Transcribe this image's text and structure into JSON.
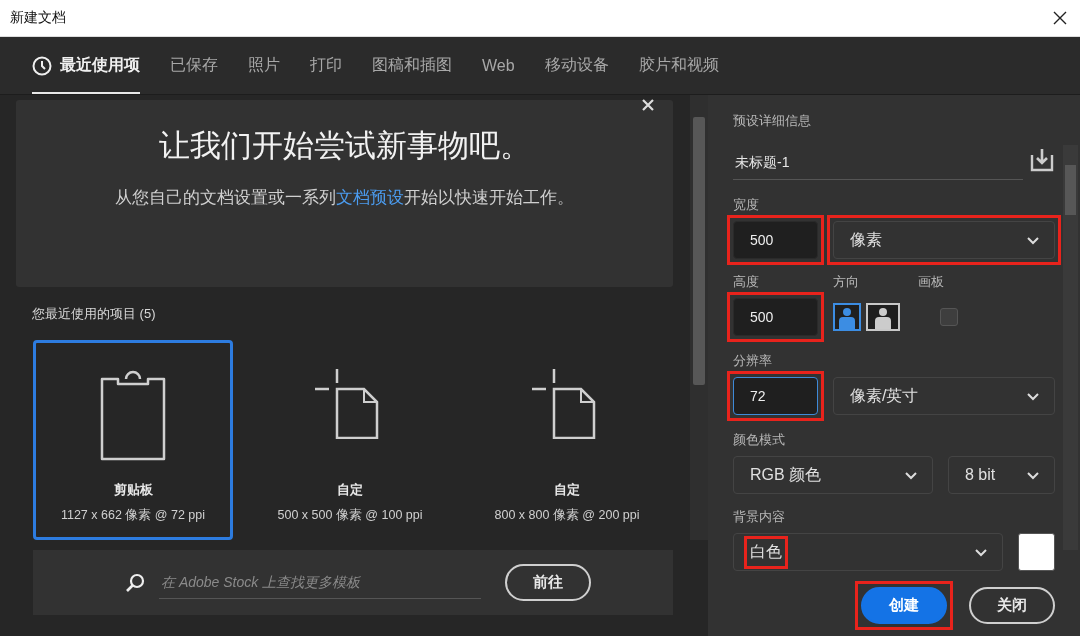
{
  "window": {
    "title": "新建文档"
  },
  "tabs": [
    {
      "label": "最近使用项",
      "selected": true,
      "kind": "icon"
    },
    {
      "label": "已保存",
      "selected": false,
      "kind": "text"
    },
    {
      "label": "照片",
      "selected": false,
      "kind": "text"
    },
    {
      "label": "打印",
      "selected": false,
      "kind": "text"
    },
    {
      "label": "图稿和插图",
      "selected": false,
      "kind": "text"
    },
    {
      "label": "Web",
      "selected": false,
      "kind": "text"
    },
    {
      "label": "移动设备",
      "selected": false,
      "kind": "text"
    },
    {
      "label": "胶片和视频",
      "selected": false,
      "kind": "text"
    }
  ],
  "welcome": {
    "title": "让我们开始尝试新事物吧。",
    "text_before": "从您自己的文档设置或一系列",
    "link": "文档预设",
    "text_after": "开始以快速开始工作。"
  },
  "recent": {
    "heading": "您最近使用的项目 (5)",
    "items": [
      {
        "kind": "clipboard",
        "name": "剪贴板",
        "size": "1127 x 662 像素 @ 72 ppi",
        "selected": true
      },
      {
        "kind": "custom",
        "name": "自定",
        "size": "500 x 500 像素 @ 100 ppi",
        "selected": false
      },
      {
        "kind": "custom",
        "name": "自定",
        "size": "800 x 800 像素 @ 200 ppi",
        "selected": false
      }
    ]
  },
  "stock": {
    "placeholder": "在 Adobe Stock 上查找更多模板",
    "button": "前往"
  },
  "preset": {
    "heading": "预设详细信息",
    "name": "未标题-1",
    "width": {
      "label": "宽度",
      "value": "500",
      "unit": "像素",
      "highlighted": true
    },
    "height": {
      "label": "高度",
      "value": "500",
      "highlighted": true
    },
    "orientation": {
      "label": "方向",
      "options": [
        {
          "kind": "portrait",
          "selected": true
        },
        {
          "kind": "landscape",
          "selected": false
        }
      ]
    },
    "artboard": {
      "label": "画板",
      "checked": false
    },
    "resolution": {
      "label": "分辨率",
      "value": "72",
      "unit": "像素/英寸",
      "highlighted": true,
      "focused": true
    },
    "color_mode": {
      "label": "颜色模式",
      "mode": "RGB 颜色",
      "depth": "8 bit"
    },
    "background": {
      "label": "背景内容",
      "value": "白色",
      "color": "#ffffff",
      "highlighted": true
    }
  },
  "actions": [
    {
      "label": "创建",
      "kind": "primary",
      "highlighted": true
    },
    {
      "label": "关闭",
      "kind": "secondary"
    }
  ]
}
